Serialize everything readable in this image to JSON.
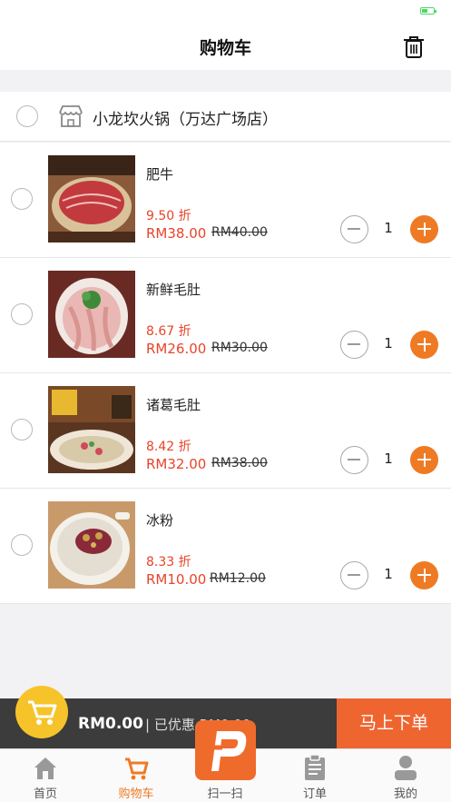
{
  "nav": {
    "title": "购物车"
  },
  "store": {
    "name": "小龙坎火锅（万达广场店）"
  },
  "items": [
    {
      "name": "肥牛",
      "discount": "9.50 折",
      "price": "RM38.00",
      "old_price": "RM40.00",
      "qty": "1"
    },
    {
      "name": "新鲜毛肚",
      "discount": "8.67 折",
      "price": "RM26.00",
      "old_price": "RM30.00",
      "qty": "1"
    },
    {
      "name": "诸葛毛肚",
      "discount": "8.42 折",
      "price": "RM32.00",
      "old_price": "RM38.00",
      "qty": "1"
    },
    {
      "name": "冰粉",
      "discount": "8.33 折",
      "price": "RM10.00",
      "old_price": "RM12.00",
      "qty": "1"
    }
  ],
  "checkout": {
    "total": "RM0.00",
    "saved": "| 已优惠 RM0.00",
    "order_label": "马上下单"
  },
  "tabs": [
    {
      "label": "首页",
      "icon": "home-icon"
    },
    {
      "label": "购物车",
      "icon": "cart-icon"
    },
    {
      "label": "扫一扫",
      "icon": "scan-icon"
    },
    {
      "label": "订单",
      "icon": "clipboard-icon"
    },
    {
      "label": "我的",
      "icon": "user-icon"
    }
  ],
  "colors": {
    "accent": "#ef7a24",
    "price": "#e8442a",
    "cart_badge": "#f6c42a",
    "checkout_bar": "#3c3c3c"
  }
}
